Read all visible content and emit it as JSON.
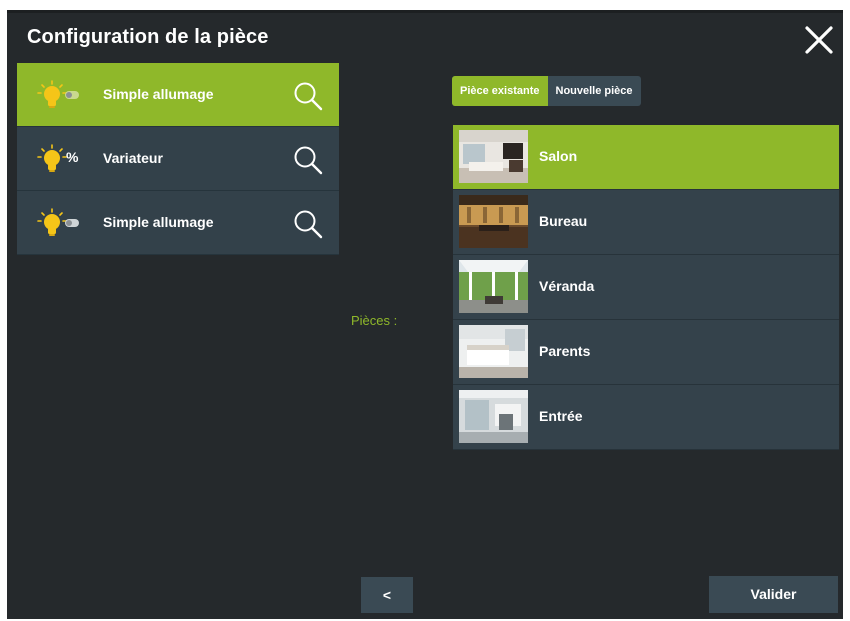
{
  "dialog": {
    "title": "Configuration de la pièce",
    "close_icon": "close-icon"
  },
  "colors": {
    "background": "#25292c",
    "accent": "#8fb82a",
    "row": "#33414a",
    "bulb": "#f5c518"
  },
  "devices": [
    {
      "label": "Simple allumage",
      "type_icon": "toggle-switch-icon",
      "selected": true
    },
    {
      "label": "Variateur",
      "type_glyph": "%",
      "type_icon": "percent-icon",
      "selected": false
    },
    {
      "label": "Simple allumage",
      "type_icon": "toggle-switch-icon",
      "selected": false
    }
  ],
  "rooms_label": "Pièces :",
  "tabs": [
    {
      "label": "Pièce existante",
      "active": true
    },
    {
      "label": "Nouvelle pièce",
      "active": false
    }
  ],
  "rooms": [
    {
      "label": "Salon",
      "selected": true
    },
    {
      "label": "Bureau",
      "selected": false
    },
    {
      "label": "Véranda",
      "selected": false
    },
    {
      "label": "Parents",
      "selected": false
    },
    {
      "label": "Entrée",
      "selected": false
    }
  ],
  "buttons": {
    "back": "<",
    "validate": "Valider"
  }
}
